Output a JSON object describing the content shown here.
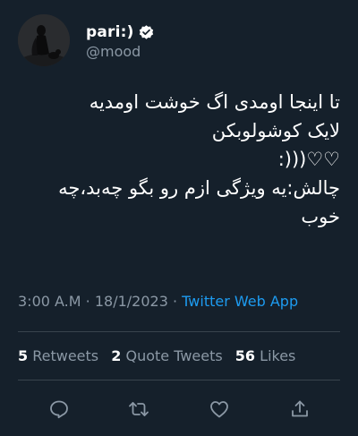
{
  "user": {
    "display_name": "pari:)",
    "handle": "@mood",
    "verified": true
  },
  "tweet": {
    "lines": [
      "تا اینجا اومدی اگ خوشت اومدیه",
      "لایک کوشولوبکن",
      ":)))♡♡",
      "چالش:یه ویژگی ازم رو بگو چه‌بد،چه",
      "خوب"
    ]
  },
  "meta": {
    "time": "3:00 A.M",
    "separator1": " · ",
    "date": "18/1/2023",
    "separator2": " · ",
    "source": "Twitter Web App"
  },
  "stats": {
    "retweets_count": "5",
    "retweets_label": "Retweets",
    "quotes_count": "2",
    "quotes_label": "Quote Tweets",
    "likes_count": "56",
    "likes_label": "Likes"
  },
  "actions": {
    "reply_icon": "reply-icon",
    "retweet_icon": "retweet-icon",
    "like_icon": "heart-icon",
    "share_icon": "share-icon"
  },
  "colors": {
    "background": "#15202b",
    "text": "#ffffff",
    "secondary": "#8b98a5",
    "accent": "#1d9bf0",
    "divider": "#38444d"
  }
}
